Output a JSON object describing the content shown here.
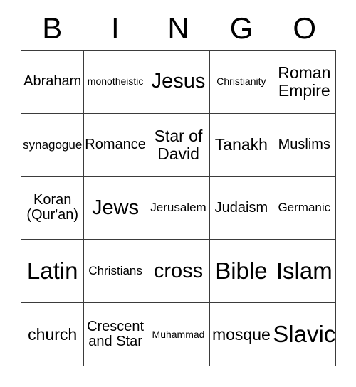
{
  "header": {
    "letters": [
      "B",
      "I",
      "N",
      "G",
      "O"
    ]
  },
  "grid": {
    "rows": [
      [
        {
          "text": "Abraham",
          "size": "fs-m"
        },
        {
          "text": "monotheistic",
          "size": "fs-xs"
        },
        {
          "text": "Jesus",
          "size": "fs-xl"
        },
        {
          "text": "Christianity",
          "size": "fs-xs"
        },
        {
          "text": "Roman Empire",
          "size": "fs-l"
        }
      ],
      [
        {
          "text": "synagogue",
          "size": "fs-s"
        },
        {
          "text": "Romance",
          "size": "fs-m"
        },
        {
          "text": "Star of David",
          "size": "fs-l"
        },
        {
          "text": "Tanakh",
          "size": "fs-l"
        },
        {
          "text": "Muslims",
          "size": "fs-m"
        }
      ],
      [
        {
          "text": "Koran (Qur'an)",
          "size": "fs-m"
        },
        {
          "text": "Jews",
          "size": "fs-xl"
        },
        {
          "text": "Jerusalem",
          "size": "fs-s"
        },
        {
          "text": "Judaism",
          "size": "fs-m"
        },
        {
          "text": "Germanic",
          "size": "fs-s"
        }
      ],
      [
        {
          "text": "Latin",
          "size": "fs-xxl"
        },
        {
          "text": "Christians",
          "size": "fs-s"
        },
        {
          "text": "cross",
          "size": "fs-xl"
        },
        {
          "text": "Bible",
          "size": "fs-xxl"
        },
        {
          "text": "Islam",
          "size": "fs-xxl"
        }
      ],
      [
        {
          "text": "church",
          "size": "fs-l"
        },
        {
          "text": "Crescent and Star",
          "size": "fs-m"
        },
        {
          "text": "Muhammad",
          "size": "fs-xs"
        },
        {
          "text": "mosque",
          "size": "fs-l"
        },
        {
          "text": "Slavic",
          "size": "fs-xxl"
        }
      ]
    ]
  }
}
